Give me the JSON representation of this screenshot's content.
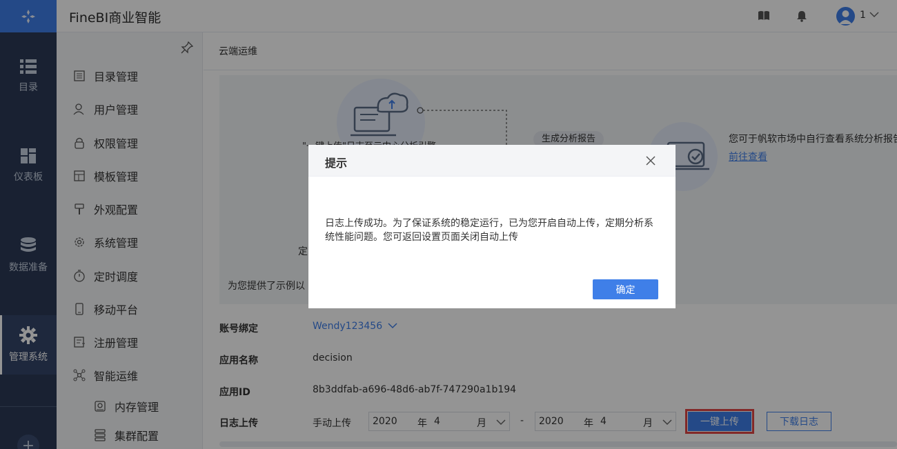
{
  "app": {
    "title": "FineBI商业智能"
  },
  "rail": {
    "items": [
      {
        "label": "目录",
        "icon": "list-icon"
      },
      {
        "label": "仪表板",
        "icon": "dashboard-icon"
      },
      {
        "label": "数据准备",
        "icon": "database-icon"
      },
      {
        "label": "管理系统",
        "icon": "gear-icon",
        "active": true
      }
    ]
  },
  "header": {
    "user_name": "1"
  },
  "submenu": {
    "items": [
      {
        "label": "目录管理",
        "icon": "catalog-icon"
      },
      {
        "label": "用户管理",
        "icon": "user-icon"
      },
      {
        "label": "权限管理",
        "icon": "lock-icon"
      },
      {
        "label": "模板管理",
        "icon": "template-icon"
      },
      {
        "label": "外观配置",
        "icon": "brush-icon"
      },
      {
        "label": "系统管理",
        "icon": "settings-icon"
      },
      {
        "label": "定时调度",
        "icon": "timer-icon"
      },
      {
        "label": "移动平台",
        "icon": "mobile-icon"
      },
      {
        "label": "注册管理",
        "icon": "register-icon"
      },
      {
        "label": "智能运维",
        "icon": "ops-icon"
      },
      {
        "label": "内存管理",
        "icon": "memory-icon"
      },
      {
        "label": "集群配置",
        "icon": "cluster-icon"
      }
    ]
  },
  "main": {
    "breadcrumb": "云端运维",
    "panel": {
      "flow_text": "\"一键上传\"日志至云中心分析引擎",
      "tag": "生成分析报告",
      "right_text": "您可于帆软市场中自行查看系统分析报告",
      "right_link": "前往查看",
      "left_partial": "定",
      "bottom_text": "为您提供了示例以"
    },
    "form": {
      "account_label": "账号绑定",
      "account_value": "Wendy123456",
      "app_name_label": "应用名称",
      "app_name_value": "decision",
      "app_id_label": "应用ID",
      "app_id_value": "8b3ddfab-a696-48d6-ab7f-747290a1b194",
      "log_label": "日志上传",
      "manual": "手动上传",
      "start": {
        "year": "2020",
        "year_unit": "年",
        "month": "4",
        "month_unit": "月"
      },
      "end": {
        "year": "2020",
        "year_unit": "年",
        "month": "4",
        "month_unit": "月"
      },
      "separator": "-",
      "upload_button": "一键上传",
      "download_button": "下载日志"
    }
  },
  "dialog": {
    "title": "提示",
    "message": "日志上传成功。为了保证系统的稳定运行，已为您开启自动上传，定期分析系统性能问题。您可返回设置页面关闭自动上传",
    "ok": "确定"
  },
  "colors": {
    "accent": "#3f7fe8",
    "rail": "#2b3a56",
    "highlight": "#e04646"
  }
}
